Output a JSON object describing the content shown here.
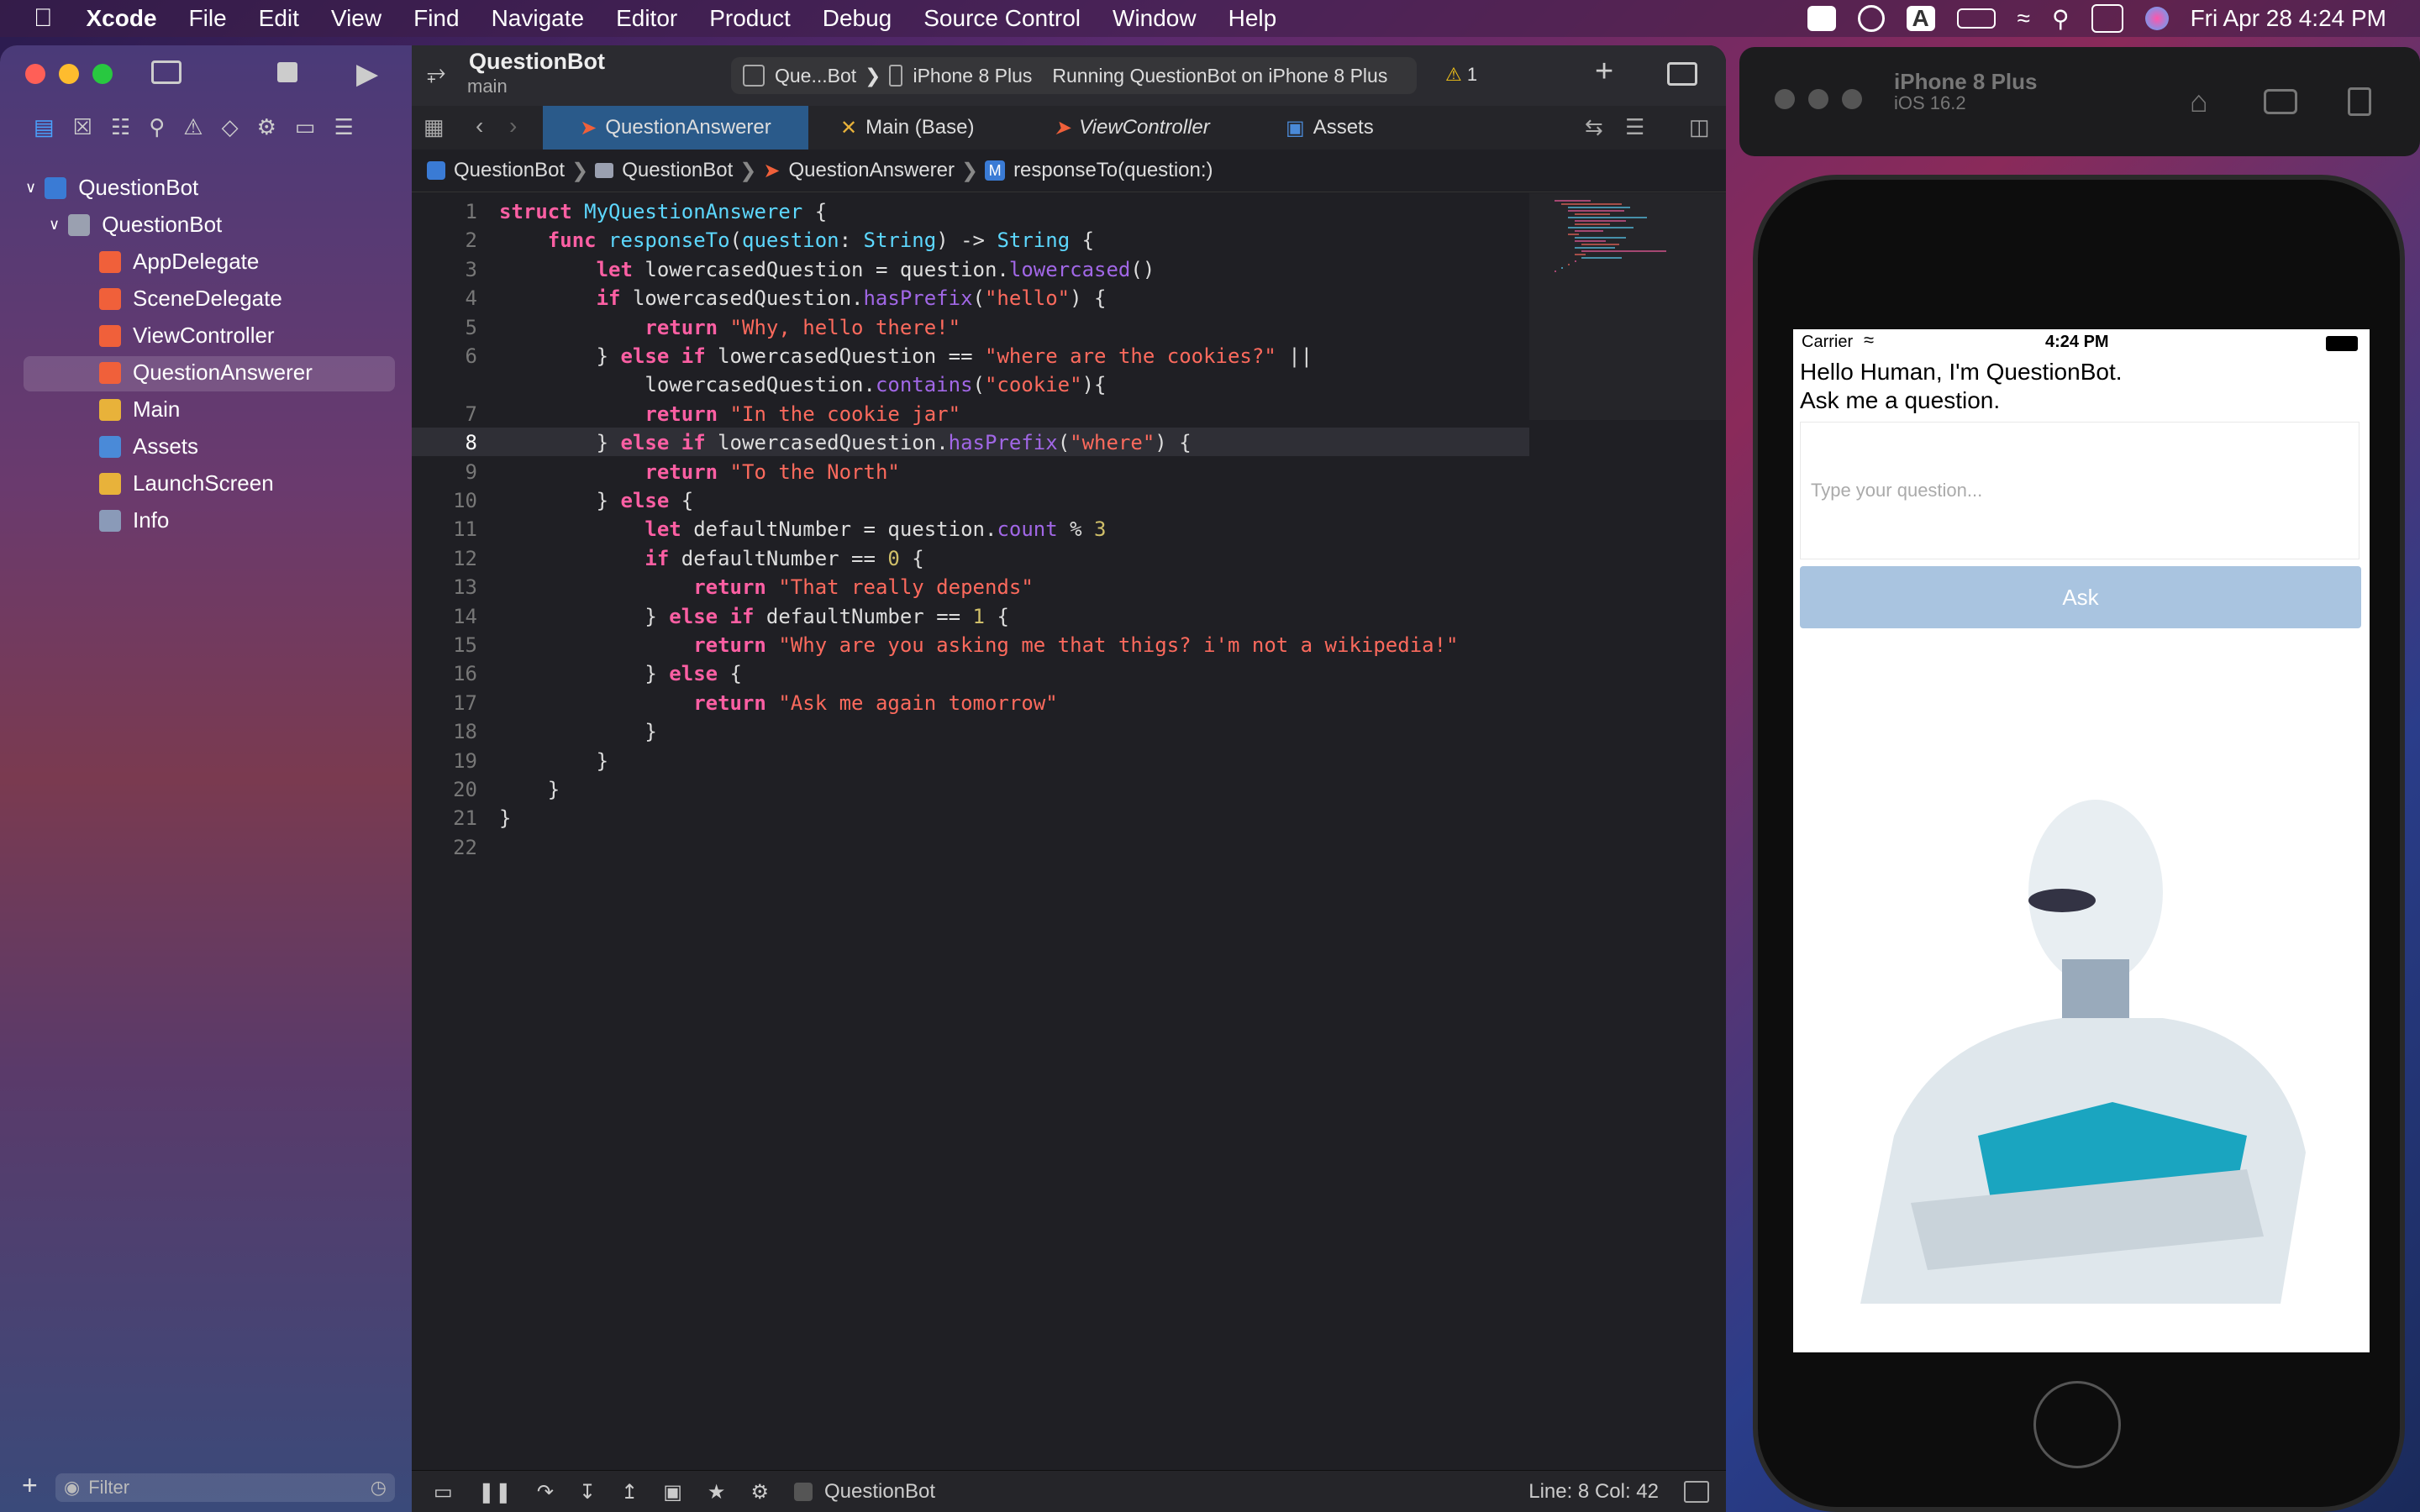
{
  "menubar": {
    "app": "Xcode",
    "items": [
      "File",
      "Edit",
      "View",
      "Find",
      "Navigate",
      "Editor",
      "Product",
      "Debug",
      "Source Control",
      "Window",
      "Help"
    ],
    "clock": "Fri Apr 28  4:24 PM"
  },
  "toolbar": {
    "project": "QuestionBot",
    "branch": "main",
    "scheme": "Que...Bot",
    "device": "iPhone 8 Plus",
    "status": "Running QuestionBot on iPhone 8 Plus",
    "warnings": "1"
  },
  "tabs": [
    "QuestionAnswerer",
    "Main (Base)",
    "ViewController",
    "Assets"
  ],
  "breadcrumb": [
    "QuestionBot",
    "QuestionBot",
    "QuestionAnswerer",
    "responseTo(question:)"
  ],
  "navigator": {
    "items": [
      {
        "label": "QuestionBot"
      },
      {
        "label": "QuestionBot"
      },
      {
        "label": "AppDelegate"
      },
      {
        "label": "SceneDelegate"
      },
      {
        "label": "ViewController"
      },
      {
        "label": "QuestionAnswerer"
      },
      {
        "label": "Main"
      },
      {
        "label": "Assets"
      },
      {
        "label": "LaunchScreen"
      },
      {
        "label": "Info"
      }
    ],
    "filter_placeholder": "Filter"
  },
  "code": {
    "line_numbers": [
      "1",
      "2",
      "3",
      "4",
      "5",
      "6",
      "",
      "7",
      "8",
      "9",
      "10",
      "11",
      "12",
      "13",
      "14",
      "15",
      "16",
      "17",
      "18",
      "19",
      "20",
      "21",
      "22"
    ],
    "lines": [
      "struct MyQuestionAnswerer {",
      "    func responseTo(question: String) -> String {",
      "        let lowercasedQuestion = question.lowercased()",
      "        if lowercasedQuestion.hasPrefix(\"hello\") {",
      "            return \"Why, hello there!\"",
      "        } else if lowercasedQuestion == \"where are the cookies?\" ||",
      "            lowercasedQuestion.contains(\"cookie\"){",
      "            return \"In the cookie jar\"",
      "        } else if lowercasedQuestion.hasPrefix(\"where\") {",
      "            return \"To the North\"",
      "        } else {",
      "            let defaultNumber = question.count % 3",
      "            if defaultNumber == 0 {",
      "                return \"That really depends\"",
      "            } else if defaultNumber == 1 {",
      "                return \"Why are you asking me that thigs? i'm not a wikipedia!\"",
      "            } else {",
      "                return \"Ask me again tomorrow\"",
      "            }",
      "        }",
      "    }",
      "}",
      ""
    ]
  },
  "bottombar": {
    "target": "QuestionBot",
    "cursor": "Line: 8  Col: 42"
  },
  "simulator": {
    "device": "iPhone 8 Plus",
    "os": "iOS 16.2",
    "carrier": "Carrier",
    "time": "4:24 PM",
    "greeting_line1": "Hello Human, I'm QuestionBot.",
    "greeting_line2": "Ask me a question.",
    "input_placeholder": "Type your question...",
    "ask_label": "Ask"
  },
  "colors": {
    "active_tab": "#2a5a8a",
    "keyword": "#fc5fa3",
    "type": "#5dd8ff",
    "function": "#a167e6",
    "string": "#fc6a5d",
    "ask_button": "#a9c4e0"
  }
}
